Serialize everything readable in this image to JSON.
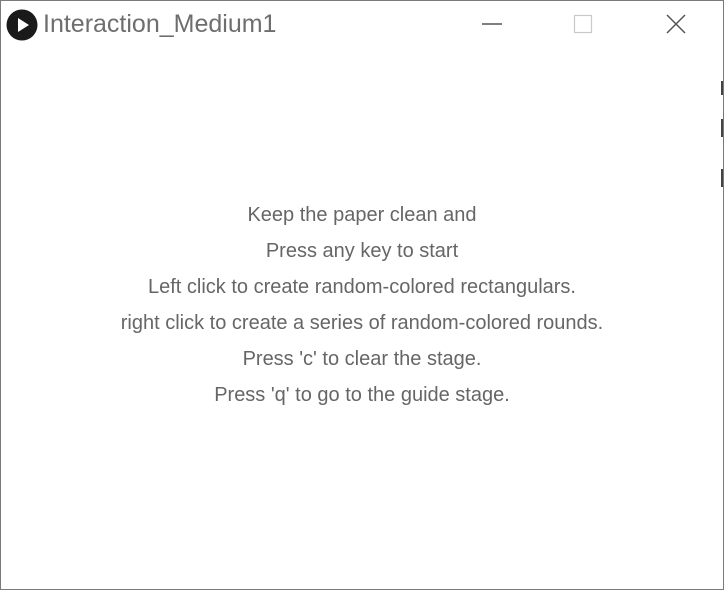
{
  "window": {
    "title": "Interaction_Medium1",
    "icon": "processing-play-icon",
    "controls": {
      "minimize": "minimize-icon",
      "maximize": "maximize-icon",
      "close": "close-icon"
    }
  },
  "stage": {
    "lines": [
      "Keep the paper clean and",
      "Press any key to start",
      "Left click to create random-colored rectangulars.",
      "right click to create a series of random-colored rounds.",
      "Press 'c' to clear the stage.",
      "Press 'q' to go to the guide stage."
    ]
  },
  "colors": {
    "background": "#ffffff",
    "text": "#666666",
    "title": "#6e6e6e",
    "icon": "#1a1a1a"
  }
}
